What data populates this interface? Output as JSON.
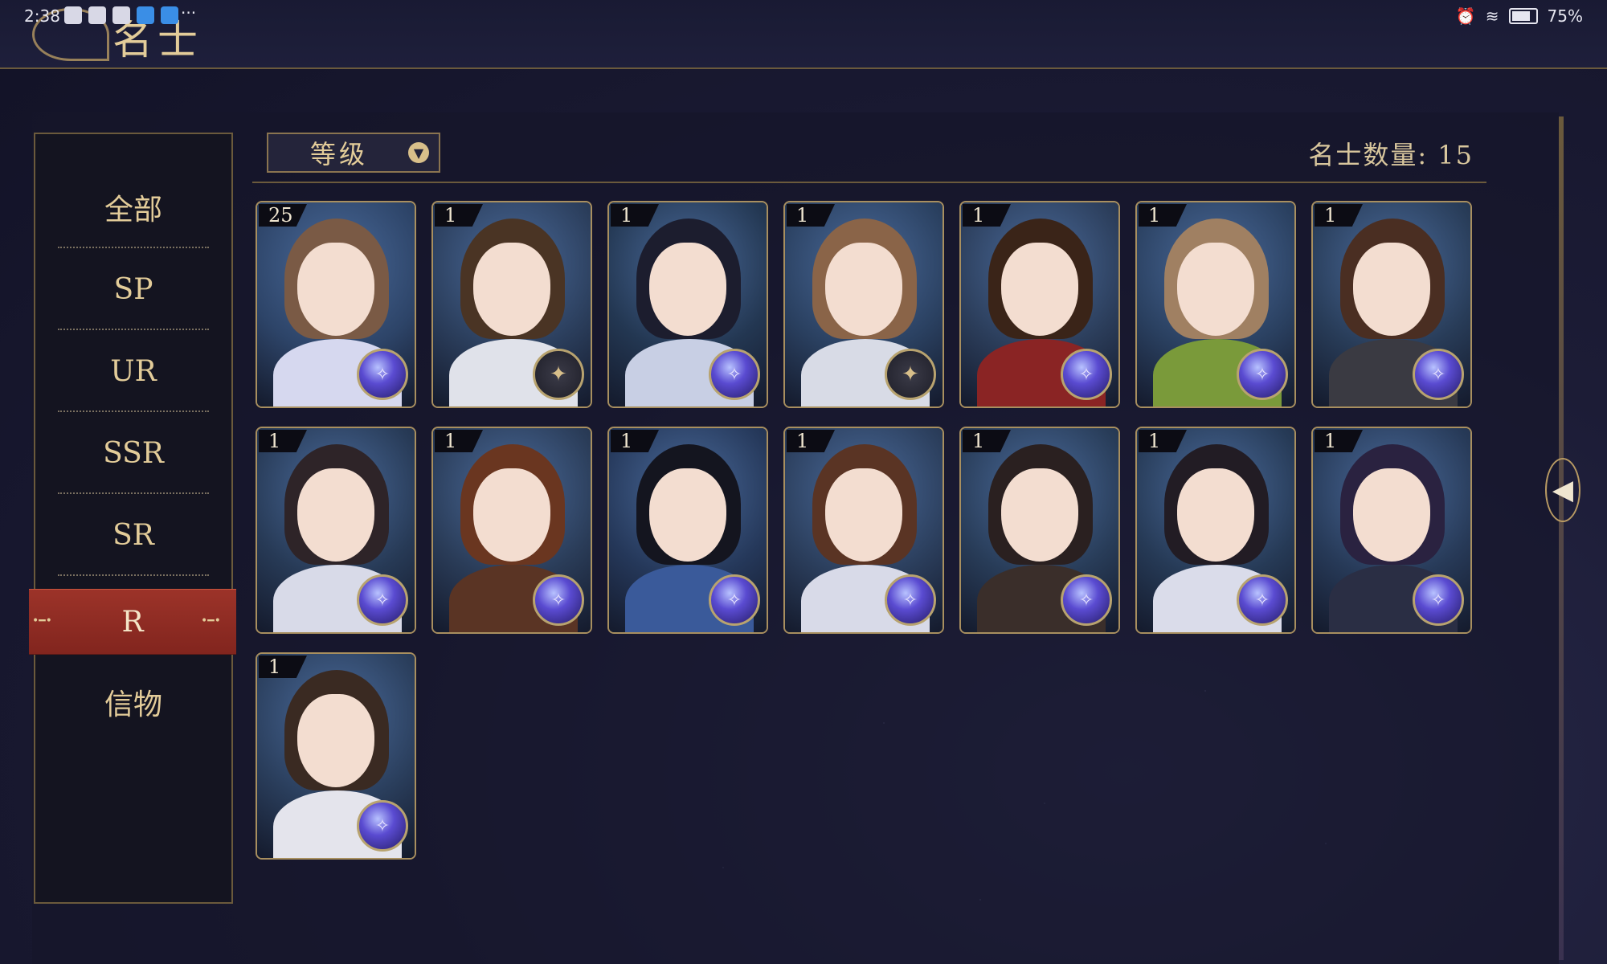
{
  "status_bar": {
    "time": "2:38",
    "more": "···",
    "battery": "75%"
  },
  "header": {
    "title": "名士"
  },
  "sidebar": {
    "items": [
      {
        "label": "全部",
        "active": false
      },
      {
        "label": "SP",
        "active": false
      },
      {
        "label": "UR",
        "active": false
      },
      {
        "label": "SSR",
        "active": false
      },
      {
        "label": "SR",
        "active": false
      },
      {
        "label": "R",
        "active": true
      },
      {
        "label": "信物",
        "active": false
      }
    ]
  },
  "filter": {
    "label": "等级"
  },
  "count": {
    "label": "名士数量: 15"
  },
  "cards": [
    {
      "level": "25",
      "element_icon": "purple-orb-icon",
      "hair": "#7a5a45",
      "body": "#d6d8ef",
      "bg": "#2d4468"
    },
    {
      "level": "1",
      "element_icon": "compass-icon",
      "hair": "#4a3424",
      "body": "#e0e2ea",
      "bg": "#2b3e5c"
    },
    {
      "level": "1",
      "element_icon": "purple-orb-icon",
      "hair": "#1c1d2e",
      "body": "#c8cfe4",
      "bg": "#233752"
    },
    {
      "level": "1",
      "element_icon": "compass-icon",
      "hair": "#8a6448",
      "body": "#d8dbe6",
      "bg": "#2a4060"
    },
    {
      "level": "1",
      "element_icon": "purple-orb-icon",
      "hair": "#3a2418",
      "body": "#8a2424",
      "bg": "#2b3d5a"
    },
    {
      "level": "1",
      "element_icon": "purple-orb-icon",
      "hair": "#a08062",
      "body": "#7a9a3a",
      "bg": "#2a4060"
    },
    {
      "level": "1",
      "element_icon": "purple-orb-icon",
      "hair": "#4a2e22",
      "body": "#3a3a42",
      "bg": "#283c58"
    },
    {
      "level": "1",
      "element_icon": "purple-orb-icon",
      "hair": "#2e2428",
      "body": "#d8dae8",
      "bg": "#273a56"
    },
    {
      "level": "1",
      "element_icon": "purple-orb-icon",
      "hair": "#6a3620",
      "body": "#5a3424",
      "bg": "#2a3c58"
    },
    {
      "level": "1",
      "element_icon": "purple-orb-icon",
      "hair": "#14151f",
      "body": "#3a5a9a",
      "bg": "#25385a"
    },
    {
      "level": "1",
      "element_icon": "purple-orb-icon",
      "hair": "#5a3424",
      "body": "#d8dae8",
      "bg": "#2b3e5c"
    },
    {
      "level": "1",
      "element_icon": "purple-orb-icon",
      "hair": "#2a2020",
      "body": "#3a2e2a",
      "bg": "#283c58"
    },
    {
      "level": "1",
      "element_icon": "purple-orb-icon",
      "hair": "#221c24",
      "body": "#dadcea",
      "bg": "#263a56"
    },
    {
      "level": "1",
      "element_icon": "purple-orb-icon",
      "hair": "#2a2240",
      "body": "#2a2e44",
      "bg": "#273a58"
    },
    {
      "level": "1",
      "element_icon": "purple-orb-icon",
      "hair": "#3a2a22",
      "body": "#e4e4ec",
      "bg": "#2a3e5c"
    }
  ]
}
